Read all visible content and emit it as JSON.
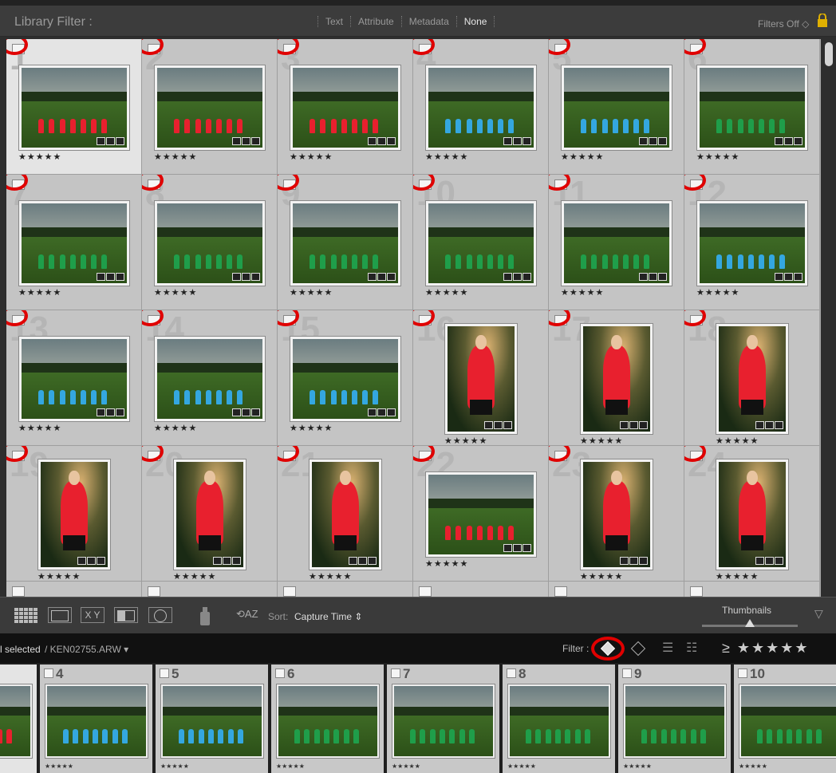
{
  "filter_bar": {
    "title": "Library Filter :",
    "tabs": [
      "Text",
      "Attribute",
      "Metadata",
      "None"
    ],
    "active_tab": "None",
    "filters_state": "Filters Off ◇"
  },
  "grid": {
    "rating_stars": "★★★★★",
    "cells": [
      {
        "num": "1",
        "kind": "team",
        "jersey": "#e8202e",
        "orient": "land",
        "selected": true
      },
      {
        "num": "2",
        "kind": "team",
        "jersey": "#e8202e",
        "orient": "land"
      },
      {
        "num": "3",
        "kind": "team",
        "jersey": "#e8202e",
        "orient": "land"
      },
      {
        "num": "4",
        "kind": "team",
        "jersey": "#34a7e0",
        "orient": "land"
      },
      {
        "num": "5",
        "kind": "team",
        "jersey": "#34a7e0",
        "orient": "land"
      },
      {
        "num": "6",
        "kind": "team",
        "jersey": "#1f9e4a",
        "orient": "land"
      },
      {
        "num": "7",
        "kind": "team",
        "jersey": "#1f9e4a",
        "orient": "land"
      },
      {
        "num": "8",
        "kind": "team",
        "jersey": "#1f9e4a",
        "orient": "land"
      },
      {
        "num": "9",
        "kind": "team",
        "jersey": "#1f9e4a",
        "orient": "land"
      },
      {
        "num": "10",
        "kind": "team",
        "jersey": "#1f9e4a",
        "orient": "land"
      },
      {
        "num": "11",
        "kind": "team",
        "jersey": "#1f9e4a",
        "orient": "land"
      },
      {
        "num": "12",
        "kind": "team",
        "jersey": "#34a7e0",
        "orient": "land"
      },
      {
        "num": "13",
        "kind": "team",
        "jersey": "#34a7e0",
        "orient": "land"
      },
      {
        "num": "14",
        "kind": "team",
        "jersey": "#34a7e0",
        "orient": "land"
      },
      {
        "num": "15",
        "kind": "team",
        "jersey": "#34a7e0",
        "orient": "land"
      },
      {
        "num": "16",
        "kind": "portrait",
        "jersey": "#e8202e",
        "orient": "port"
      },
      {
        "num": "17",
        "kind": "portrait",
        "jersey": "#e8202e",
        "orient": "port"
      },
      {
        "num": "18",
        "kind": "portrait",
        "jersey": "#e8202e",
        "orient": "port"
      },
      {
        "num": "19",
        "kind": "portrait",
        "jersey": "#e8202e",
        "orient": "port"
      },
      {
        "num": "20",
        "kind": "portrait",
        "jersey": "#e8202e",
        "orient": "port"
      },
      {
        "num": "21",
        "kind": "portrait",
        "jersey": "#e8202e",
        "orient": "port"
      },
      {
        "num": "22",
        "kind": "team",
        "jersey": "#e8202e",
        "orient": "land"
      },
      {
        "num": "23",
        "kind": "portrait",
        "jersey": "#e8202e",
        "orient": "port"
      },
      {
        "num": "24",
        "kind": "portrait",
        "jersey": "#e8202e",
        "orient": "port"
      }
    ]
  },
  "toolbar": {
    "view_buttons": [
      "grid-view",
      "loupe-view",
      "compare-view",
      "survey-view",
      "people-view"
    ],
    "compare_label": "X Y",
    "sort_label": "Sort:",
    "sort_value": "Capture Time ⇕",
    "thumbnails_label": "Thumbnails",
    "thumbnail_size": 0.5
  },
  "status_bar": {
    "selected_text": "l selected",
    "filename": "/ KEN02755.ARW ▾",
    "filter_label": "Filter :",
    "rating_filter": "≥ ★★★★★"
  },
  "filmstrip": {
    "rating_stars": "★★★★★",
    "frames": [
      {
        "num": "",
        "jersey": "#e8202e"
      },
      {
        "num": "4",
        "jersey": "#34a7e0"
      },
      {
        "num": "5",
        "jersey": "#34a7e0"
      },
      {
        "num": "6",
        "jersey": "#1f9e4a"
      },
      {
        "num": "7",
        "jersey": "#1f9e4a"
      },
      {
        "num": "8",
        "jersey": "#1f9e4a"
      },
      {
        "num": "9",
        "jersey": "#1f9e4a"
      },
      {
        "num": "10",
        "jersey": "#1f9e4a"
      }
    ]
  },
  "colors": {
    "annotation_red": "#e00000",
    "panel_bg": "#3a3a3a",
    "grid_cell": "#c4c4c4"
  }
}
